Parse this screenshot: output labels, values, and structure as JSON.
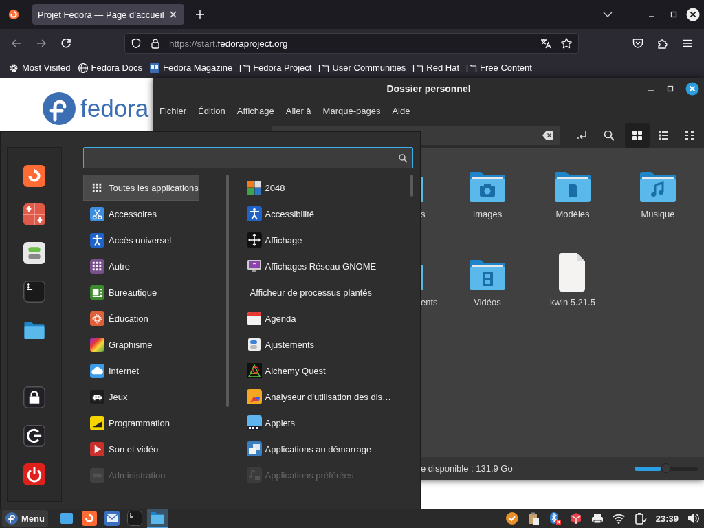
{
  "browser": {
    "tabs": [
      {
        "title": "Projet Fedora — Page d’accueil",
        "selected": true
      }
    ],
    "address": {
      "prefix": "https://start.",
      "domain": "fedoraproject.org"
    },
    "bookmarks": [
      {
        "label": "Most Visited",
        "kind": "gear"
      },
      {
        "label": "Fedora Docs",
        "kind": "globe"
      },
      {
        "label": "Fedora Magazine",
        "kind": "site"
      },
      {
        "label": "Fedora Project",
        "kind": "folder"
      },
      {
        "label": "User Communities",
        "kind": "folder"
      },
      {
        "label": "Red Hat",
        "kind": "folder"
      },
      {
        "label": "Free Content",
        "kind": "folder"
      }
    ],
    "page": {
      "logo_text": "fedora"
    }
  },
  "file_manager": {
    "title": "Dossier personnel",
    "menu": [
      "Fichier",
      "Édition",
      "Affichage",
      "Aller à",
      "Marque-pages",
      "Aide"
    ],
    "view_modes": [
      {
        "kind": "icons",
        "selected": true
      },
      {
        "kind": "list",
        "selected": false
      },
      {
        "kind": "compact",
        "selected": false
      }
    ],
    "files": [
      {
        "label": "s",
        "kind": "partial"
      },
      {
        "label": "Images",
        "kind": "pictures"
      },
      {
        "label": "Modèles",
        "kind": "templates"
      },
      {
        "label": "Musique",
        "kind": "music"
      },
      {
        "label": "ents",
        "kind": "partial"
      },
      {
        "label": "Vidéos",
        "kind": "videos"
      },
      {
        "label": "kwin 5.21.5",
        "kind": "file"
      }
    ],
    "status": "e disponible : 131,9 Go",
    "zoom": {
      "level": 0.42
    }
  },
  "app_menu": {
    "search": {
      "focused": true
    },
    "categories": [
      {
        "label": "Toutes les applications",
        "selected": true,
        "dimmed": false
      },
      {
        "label": "Accessoires",
        "selected": false,
        "dimmed": false
      },
      {
        "label": "Accès universel",
        "selected": false,
        "dimmed": false
      },
      {
        "label": "Autre",
        "selected": false,
        "dimmed": false
      },
      {
        "label": "Bureautique",
        "selected": false,
        "dimmed": false
      },
      {
        "label": "Éducation",
        "selected": false,
        "dimmed": false
      },
      {
        "label": "Graphisme",
        "selected": false,
        "dimmed": false
      },
      {
        "label": "Internet",
        "selected": false,
        "dimmed": false
      },
      {
        "label": "Jeux",
        "selected": false,
        "dimmed": false
      },
      {
        "label": "Programmation",
        "selected": false,
        "dimmed": false
      },
      {
        "label": "Son et vidéo",
        "selected": false,
        "dimmed": false
      },
      {
        "label": "Administration",
        "selected": false,
        "dimmed": true
      }
    ],
    "apps": [
      {
        "label": "2048",
        "dimmed": false
      },
      {
        "label": "Accessibilité",
        "dimmed": false
      },
      {
        "label": "Affichage",
        "dimmed": false
      },
      {
        "label": "Affichages Réseau GNOME",
        "dimmed": false
      },
      {
        "label": "Afficheur de processus plantés",
        "dimmed": false
      },
      {
        "label": "Agenda",
        "dimmed": false
      },
      {
        "label": "Ajustements",
        "dimmed": false
      },
      {
        "label": "Alchemy Quest",
        "dimmed": false
      },
      {
        "label": "Analyseur d’utilisation des dis…",
        "dimmed": false
      },
      {
        "label": "Applets",
        "dimmed": false
      },
      {
        "label": "Applications au démarrage",
        "dimmed": false
      },
      {
        "label": "Applications préférées",
        "dimmed": true
      }
    ]
  },
  "taskbar": {
    "menu_label": "Menu",
    "launchers": [
      {
        "kind": "desktop",
        "active": false
      },
      {
        "kind": "browser",
        "active": false
      },
      {
        "kind": "mail",
        "active": false
      },
      {
        "kind": "terminal",
        "active": false
      },
      {
        "kind": "files",
        "active": true
      }
    ],
    "clock": "23:39"
  }
}
